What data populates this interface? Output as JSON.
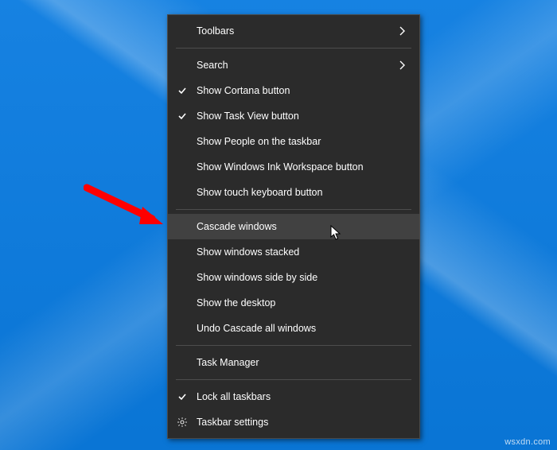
{
  "wallpaper": {
    "accent": "#0a7be0"
  },
  "watermark": "wsxdn.com",
  "menu": {
    "toolbars": {
      "label": "Toolbars",
      "hasSubmenu": true
    },
    "search": {
      "label": "Search",
      "hasSubmenu": true
    },
    "cortana": {
      "label": "Show Cortana button",
      "checked": true
    },
    "taskview": {
      "label": "Show Task View button",
      "checked": true
    },
    "people": {
      "label": "Show People on the taskbar"
    },
    "ink": {
      "label": "Show Windows Ink Workspace button"
    },
    "touchkb": {
      "label": "Show touch keyboard button"
    },
    "cascade": {
      "label": "Cascade windows",
      "hovered": true
    },
    "stacked": {
      "label": "Show windows stacked"
    },
    "sidebyside": {
      "label": "Show windows side by side"
    },
    "showdesk": {
      "label": "Show the desktop"
    },
    "undo": {
      "label": "Undo Cascade all windows"
    },
    "taskmgr": {
      "label": "Task Manager"
    },
    "lockall": {
      "label": "Lock all taskbars",
      "checked": true
    },
    "settings": {
      "label": "Taskbar settings",
      "icon": "gear"
    }
  }
}
